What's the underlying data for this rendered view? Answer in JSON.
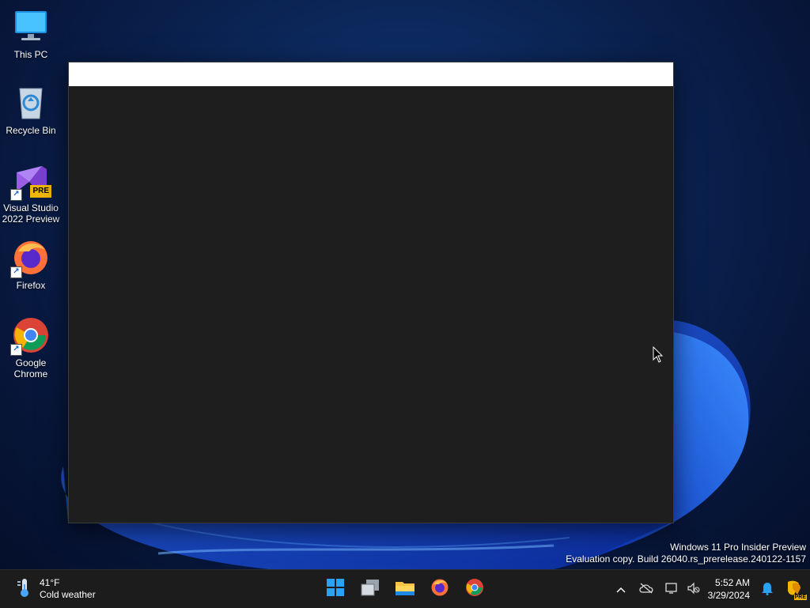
{
  "desktop": {
    "icons": [
      {
        "label": "This PC",
        "icon": "monitor-icon"
      },
      {
        "label": "Recycle Bin",
        "icon": "recycle-bin-icon"
      },
      {
        "label": "Visual Studio 2022 Preview",
        "icon": "visual-studio-icon",
        "badge": "PRE"
      },
      {
        "label": "Firefox",
        "icon": "firefox-icon"
      },
      {
        "label": "Google Chrome",
        "icon": "chrome-icon"
      }
    ]
  },
  "watermark": {
    "line1": "Windows 11 Pro Insider Preview",
    "line2": "Evaluation copy. Build 26040.rs_prerelease.240122-1157"
  },
  "taskbar": {
    "weather": {
      "temp": "41°F",
      "condition": "Cold weather",
      "icon": "thermometer-icon"
    },
    "pinned": [
      "start-icon",
      "task-view-icon",
      "file-explorer-icon",
      "firefox-icon",
      "chrome-icon"
    ],
    "tray": {
      "time": "5:52 AM",
      "date": "3/29/2024"
    }
  },
  "colors": {
    "taskbar": "#1c1c1c",
    "window_body": "#1e1e1e",
    "window_titlebar": "#ffffff",
    "accent": "#2aa3f5"
  }
}
